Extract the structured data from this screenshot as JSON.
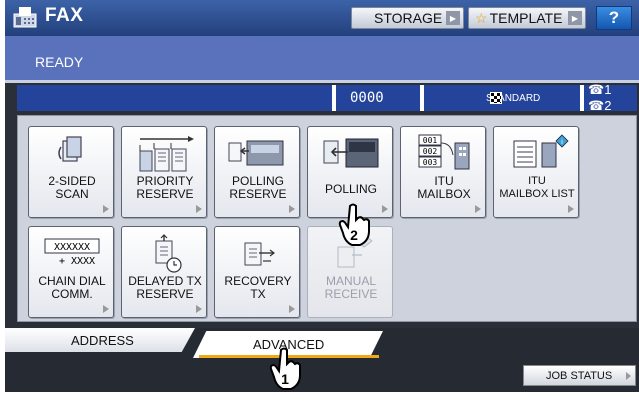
{
  "header": {
    "title": "FAX",
    "storage_label": "STORAGE",
    "template_label": "TEMPLATE",
    "help_label": "?"
  },
  "status": {
    "text": "READY"
  },
  "info": {
    "address": "",
    "counter": "0000",
    "resolution": "STANDARD",
    "lines": "☎1 ☎2"
  },
  "functions": [
    {
      "label1": "2-SIDED",
      "label2": "SCAN",
      "enabled": true,
      "icon": "two-sided-scan-icon"
    },
    {
      "label1": "PRIORITY",
      "label2": "RESERVE",
      "enabled": true,
      "icon": "priority-reserve-icon"
    },
    {
      "label1": "POLLING",
      "label2": "RESERVE",
      "enabled": true,
      "icon": "polling-reserve-icon"
    },
    {
      "label1": "POLLING",
      "label2": "",
      "enabled": true,
      "icon": "polling-icon"
    },
    {
      "label1": "ITU",
      "label2": "MAILBOX",
      "enabled": true,
      "icon": "itu-mailbox-icon"
    },
    {
      "label1": "ITU",
      "label2": "MAILBOX LIST",
      "enabled": true,
      "icon": "itu-mailbox-list-icon"
    },
    {
      "label1": "CHAIN DIAL",
      "label2": "COMM.",
      "enabled": true,
      "icon": "chain-dial-icon"
    },
    {
      "label1": "DELAYED TX",
      "label2": "RESERVE",
      "enabled": true,
      "icon": "delayed-tx-icon"
    },
    {
      "label1": "RECOVERY",
      "label2": "TX",
      "enabled": true,
      "icon": "recovery-tx-icon"
    },
    {
      "label1": "MANUAL",
      "label2": "RECEIVE",
      "enabled": false,
      "icon": "manual-receive-icon"
    }
  ],
  "mailbox_numbers": [
    "001",
    "002",
    "003"
  ],
  "chain_dial": {
    "top": "XXXXXX",
    "bottom": "+ XXXX"
  },
  "tabs": {
    "address": "ADDRESS",
    "advanced": "ADVANCED",
    "active": "advanced"
  },
  "footer": {
    "job_status_label": "JOB STATUS"
  },
  "callouts": {
    "step1": "1",
    "step2": "2"
  },
  "colors": {
    "header": "#2a4a8e",
    "status": "#5a72bc",
    "info": "#24439a",
    "tab_accent": "#f0a818"
  }
}
